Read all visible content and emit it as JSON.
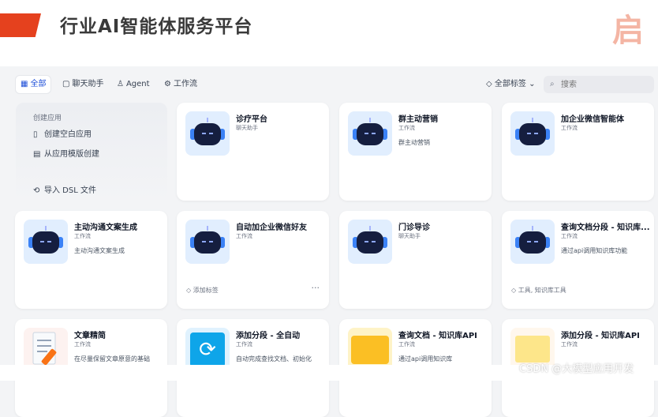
{
  "header": {
    "title": "行业AI智能体服务平台",
    "logo_text": "启"
  },
  "filters": {
    "tabs": [
      {
        "label": "全部",
        "icon": "grid-icon"
      },
      {
        "label": "聊天助手",
        "icon": "chat-icon"
      },
      {
        "label": "Agent",
        "icon": "agent-icon"
      },
      {
        "label": "工作流",
        "icon": "workflow-icon"
      }
    ],
    "tag_select": "全部标签",
    "search_placeholder": "搜索"
  },
  "create": {
    "section": "创建应用",
    "blank": "创建空白应用",
    "template": "从应用模版创建",
    "import": "导入 DSL 文件"
  },
  "apps": [
    {
      "name": "诊疗平台",
      "type": "聊天助手",
      "desc": ""
    },
    {
      "name": "群主动营销",
      "type": "工作流",
      "desc": "群主动营销"
    },
    {
      "name": "加企业微信智能体",
      "type": "工作流",
      "desc": ""
    },
    {
      "name": "主动沟通文案生成",
      "type": "工作流",
      "desc": "主动沟通文案生成"
    },
    {
      "name": "自动加企业微信好友",
      "type": "工作流",
      "desc": "",
      "tag": "添加标签",
      "more": "···"
    },
    {
      "name": "门诊导诊",
      "type": "聊天助手",
      "desc": ""
    },
    {
      "name": "查询文档分段 - 知识库...",
      "type": "工作流",
      "desc": "通过api调用知识库功能",
      "tag": "工具, 知识库工具"
    },
    {
      "name": "文章精简",
      "type": "工作流",
      "desc": "在尽量保留文章原意的基础"
    },
    {
      "name": "添加分段 - 全自动",
      "type": "工作流",
      "desc": "自动完成查找文档、初始化"
    },
    {
      "name": "查询文档 - 知识库API",
      "type": "工作流",
      "desc": "通过api调用知识库"
    },
    {
      "name": "添加分段 - 知识库API",
      "type": "工作流",
      "desc": ""
    }
  ],
  "watermark": "CSDN @大模型应用开发",
  "colors": {
    "accent": "#e5411e",
    "link": "#1d4ed8",
    "robot_bg": "#e1eefe"
  }
}
